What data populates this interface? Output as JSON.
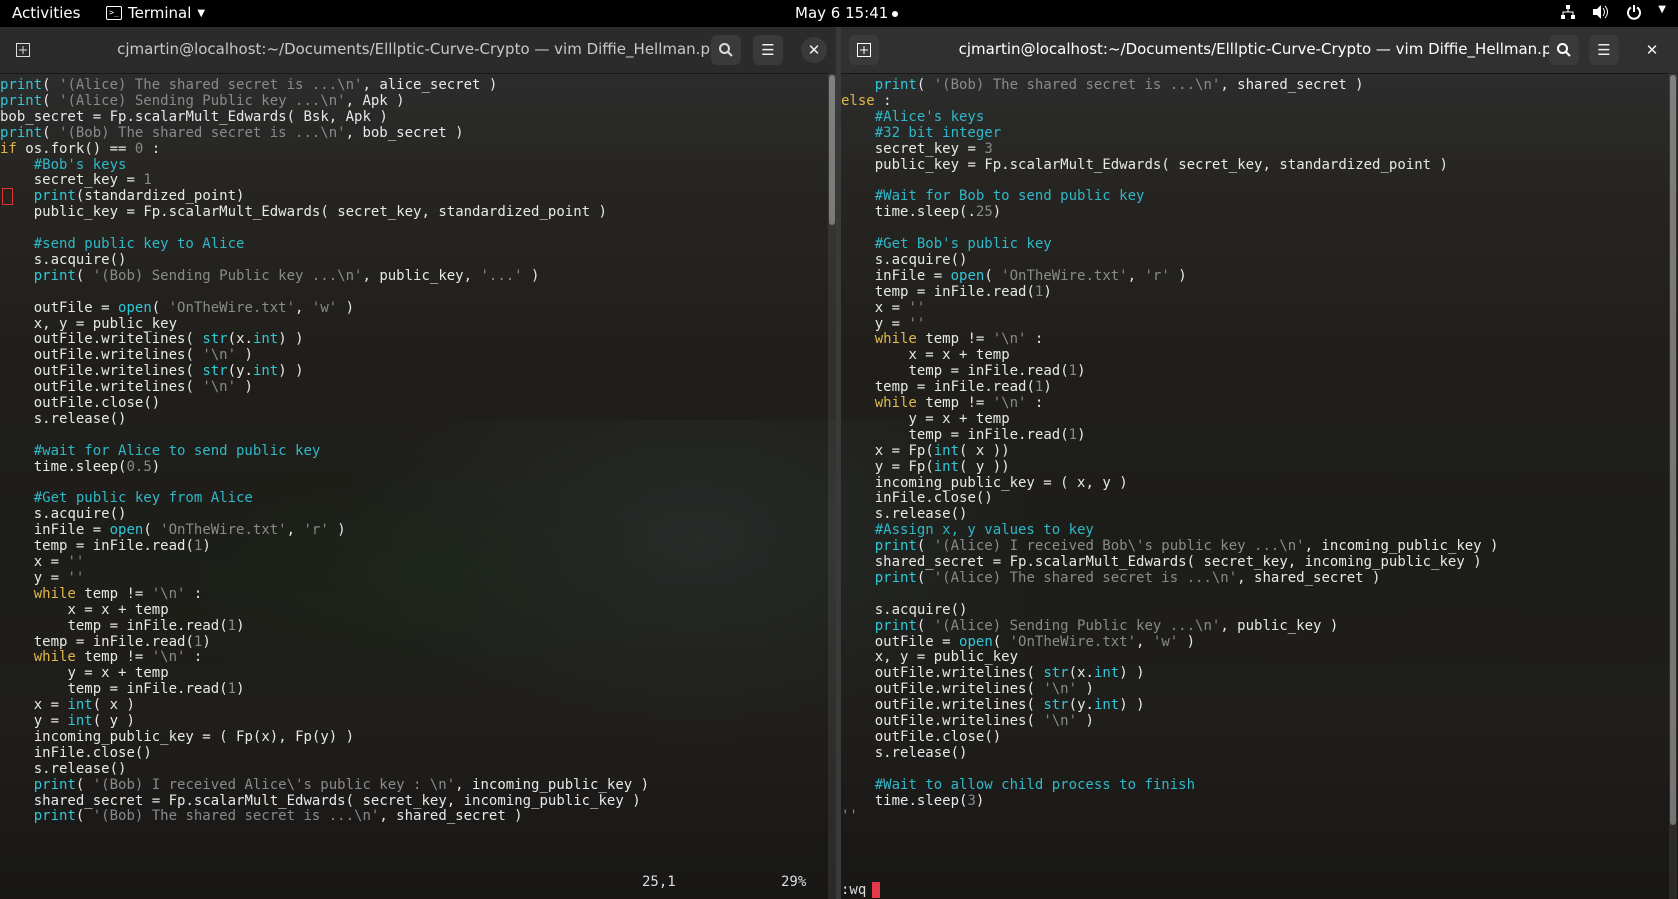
{
  "topbar": {
    "activities": "Activities",
    "app_name": "Terminal",
    "clock": "May 6  15:41"
  },
  "left_window": {
    "title": "cjmartin@localhost:~/Documents/Elllptic-Curve-Crypto — vim Diffie_Hellman.py",
    "ruler_position": "25,1",
    "ruler_percent": "29%",
    "lines": [
      "print( '(Alice) The shared secret is ...\\n', alice_secret )",
      "print( '(Alice) Sending Public key ...\\n', Apk )",
      "bob_secret = Fp.scalarMult_Edwards( Bsk, Apk )",
      "print( '(Bob) The shared secret is ...\\n', bob_secret )",
      "if os.fork() == 0 :",
      "    #Bob's keys",
      "    secret_key = 1",
      "    print(standardized_point)",
      "    public_key = Fp.scalarMult_Edwards( secret_key, standardized_point )",
      "",
      "    #send public key to Alice",
      "    s.acquire()",
      "    print( '(Bob) Sending Public key ...\\n', public_key, '...' )",
      "",
      "    outFile = open( 'OnTheWire.txt', 'w' )",
      "    x, y = public_key",
      "    outFile.writelines( str(x.int) )",
      "    outFile.writelines( '\\n' )",
      "    outFile.writelines( str(y.int) )",
      "    outFile.writelines( '\\n' )",
      "    outFile.close()",
      "    s.release()",
      "",
      "    #wait for Alice to send public key",
      "    time.sleep(0.5)",
      "",
      "    #Get public key from Alice",
      "    s.acquire()",
      "    inFile = open( 'OnTheWire.txt', 'r' )",
      "    temp = inFile.read(1)",
      "    x = ''",
      "    y = ''",
      "    while temp != '\\n' :",
      "        x = x + temp",
      "        temp = inFile.read(1)",
      "    temp = inFile.read(1)",
      "    while temp != '\\n' :",
      "        y = x + temp",
      "        temp = inFile.read(1)",
      "    x = int( x )",
      "    y = int( y )",
      "    incoming_public_key = ( Fp(x), Fp(y) )",
      "    inFile.close()",
      "    s.release()",
      "    print( '(Bob) I received Alice\\'s public key : \\n', incoming_public_key )",
      "    shared_secret = Fp.scalarMult_Edwards( secret_key, incoming_public_key )",
      "    print( '(Bob) The shared secret is ...\\n', shared_secret )"
    ]
  },
  "right_window": {
    "title": "cjmartin@localhost:~/Documents/Elllptic-Curve-Crypto — vim Diffie_Hellman.py",
    "command_line": ":wq",
    "lines": [
      "    print( '(Bob) The shared secret is ...\\n', shared_secret )",
      "else :",
      "    #Alice's keys",
      "    #32 bit integer",
      "    secret_key = 3",
      "    public_key = Fp.scalarMult_Edwards( secret_key, standardized_point )",
      "",
      "    #Wait for Bob to send public key",
      "    time.sleep(.25)",
      "",
      "    #Get Bob's public key",
      "    s.acquire()",
      "    inFile = open( 'OnTheWire.txt', 'r' )",
      "    temp = inFile.read(1)",
      "    x = ''",
      "    y = ''",
      "    while temp != '\\n' :",
      "        x = x + temp",
      "        temp = inFile.read(1)",
      "    temp = inFile.read(1)",
      "    while temp != '\\n' :",
      "        y = x + temp",
      "        temp = inFile.read(1)",
      "    x = Fp(int( x ))",
      "    y = Fp(int( y ))",
      "    incoming_public_key = ( x, y )",
      "    inFile.close()",
      "    s.release()",
      "    #Assign x, y values to key",
      "    print( '(Alice) I received Bob\\'s public key ...\\n', incoming_public_key )",
      "    shared_secret = Fp.scalarMult_Edwards( secret_key, incoming_public_key )",
      "    print( '(Alice) The shared secret is ...\\n', shared_secret )",
      "",
      "    s.acquire()",
      "    print( '(Alice) Sending Public key ...\\n', public_key )",
      "    outFile = open( 'OnTheWire.txt', 'w' )",
      "    x, y = public_key",
      "    outFile.writelines( str(x.int) )",
      "    outFile.writelines( '\\n' )",
      "    outFile.writelines( str(y.int) )",
      "    outFile.writelines( '\\n' )",
      "    outFile.close()",
      "    s.release()",
      "",
      "    #Wait to allow child process to finish",
      "    time.sleep(3)",
      "'''"
    ]
  },
  "colors": {
    "keyword": "#e0b84a",
    "builtin": "#30c8d8",
    "string": "#8a8a8a",
    "comment": "#2fb8c8",
    "number": "#8a8a8a",
    "text": "#e8e8e8",
    "cursor": "#e23a4a"
  },
  "icons": {
    "new_tab": "new-tab-icon",
    "search": "search-icon",
    "menu": "hamburger-menu-icon",
    "close": "close-icon",
    "network": "network-icon",
    "volume": "volume-icon",
    "power": "power-icon"
  }
}
